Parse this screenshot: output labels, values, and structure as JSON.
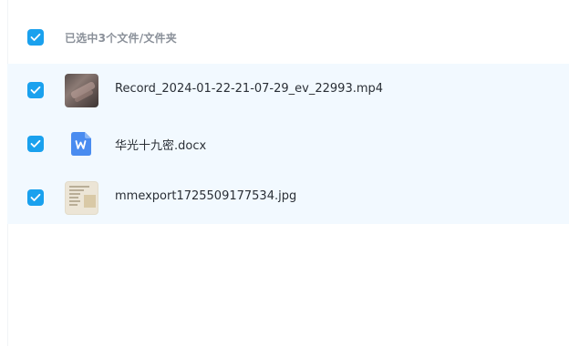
{
  "header": {
    "selection_text": "已选中3个文件/文件夹",
    "checked": true
  },
  "files": [
    {
      "name": "Record_2024-01-22-21-07-29_ev_22993.mp4",
      "type": "video",
      "icon": "video-thumbnail",
      "checked": true
    },
    {
      "name": "华光十九密.docx",
      "type": "docx",
      "icon": "word-doc-icon",
      "checked": true
    },
    {
      "name": "mmexport1725509177534.jpg",
      "type": "image",
      "icon": "image-thumbnail",
      "checked": true
    }
  ],
  "colors": {
    "checkbox_blue": "#1aa1ee",
    "row_highlight": "#f2f9ff",
    "word_blue": "#4a8cf0",
    "header_text": "#8a9099"
  }
}
